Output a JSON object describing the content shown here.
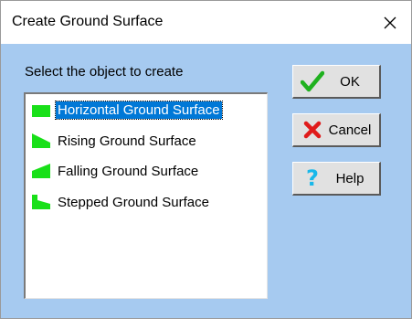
{
  "window": {
    "title": "Create Ground Surface",
    "close_icon": "close-icon"
  },
  "dialog": {
    "prompt": "Select the object to create",
    "items": [
      {
        "label": "Horizontal Ground Surface",
        "icon": "horizontal-ground-icon",
        "selected": true
      },
      {
        "label": "Rising Ground Surface",
        "icon": "rising-ground-icon",
        "selected": false
      },
      {
        "label": "Falling Ground Surface",
        "icon": "falling-ground-icon",
        "selected": false
      },
      {
        "label": "Stepped Ground Surface",
        "icon": "stepped-ground-icon",
        "selected": false
      }
    ],
    "buttons": {
      "ok": "OK",
      "cancel": "Cancel",
      "help": "Help"
    }
  },
  "colors": {
    "background": "#a6caf0",
    "ground_green": "#19e019",
    "selection": "#0078d7"
  }
}
